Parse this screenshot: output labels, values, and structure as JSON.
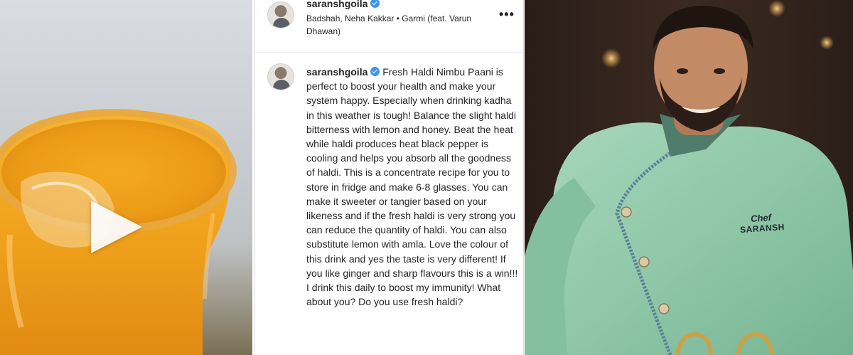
{
  "post": {
    "header": {
      "username": "saranshgoila",
      "audio": "Badshah, Neha Kakkar • Garmi (feat. Varun Dhawan)",
      "more_icon": "more-horizontal-icon",
      "more_label": "•••"
    },
    "caption": {
      "username": "saranshgoila",
      "text": "Fresh Haldi Nimbu Paani is perfect to boost your health and make your system happy. Especially when drinking kadha in this weather is tough! Balance the slight haldi bitterness with lemon and honey. Beat the heat while haldi produces heat black pepper is cooling and helps you absorb all the goodness of haldi.  This is a concentrate recipe for you to store in fridge and make 6-8 glasses. You can make it sweeter or tangier based on your likeness and if the fresh haldi is very strong you can reduce the quantity of haldi. You can also substitute lemon with amla. Love the colour of this drink and yes the taste is very different! If you like ginger and sharp flavours this is a win!!! I drink this daily to boost my immunity! What about you? Do you use fresh haldi?"
    }
  },
  "video": {
    "play_icon": "play-icon"
  },
  "photo": {
    "logo_line1": "Chef",
    "logo_line2": "SARANSH"
  },
  "colors": {
    "verified": "#3897f0",
    "jacket": "#8fc7a8",
    "drink": "#f0a21c"
  }
}
